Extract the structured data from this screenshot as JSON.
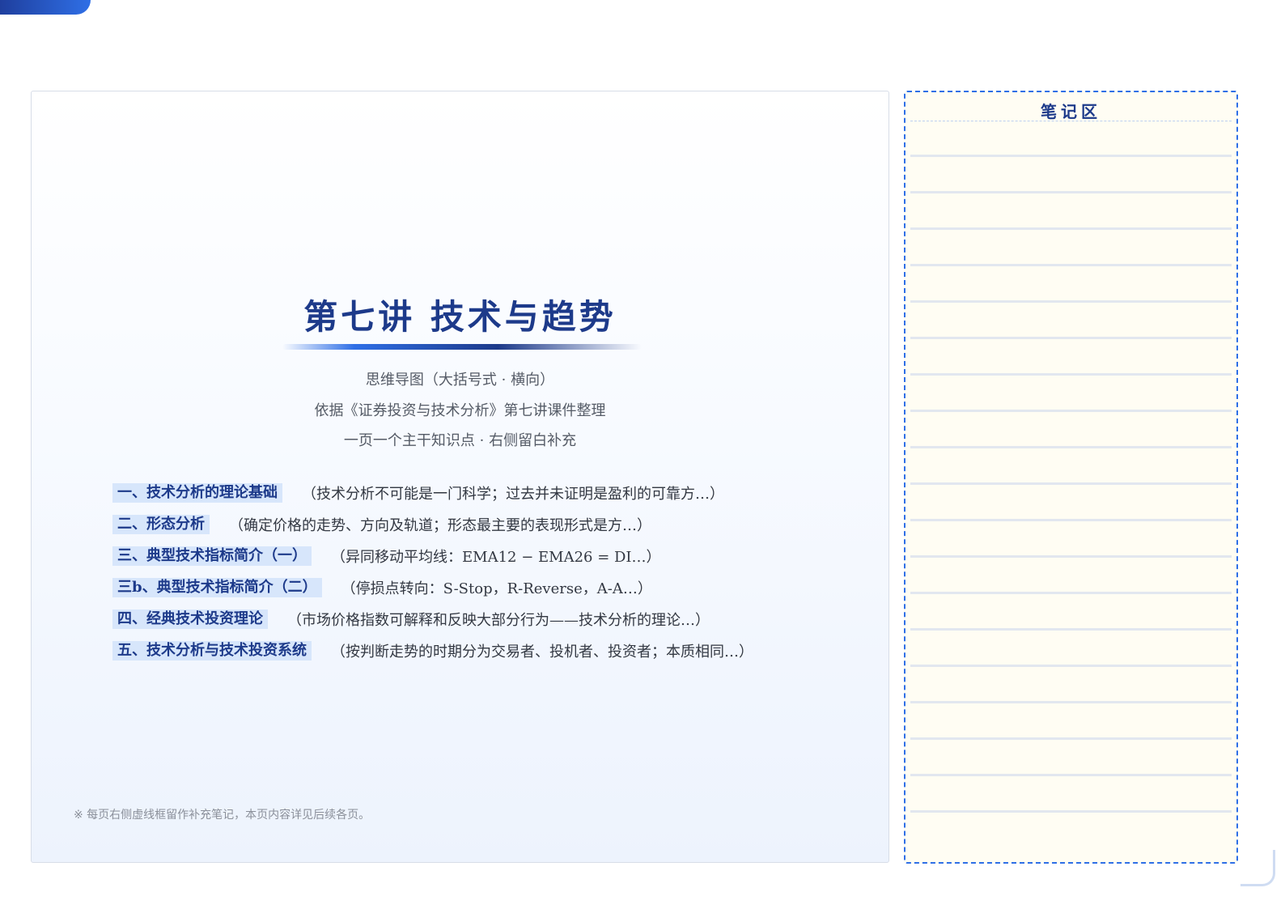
{
  "main": {
    "title": "第七讲  技术与趋势",
    "subtitles": [
      "思维导图（大括号式 · 横向）",
      "依据《证券投资与技术分析》第七讲课件整理",
      "一页一个主干知识点 · 右侧留白补充"
    ],
    "topics": [
      {
        "label": "一、技术分析的理论基础",
        "desc": "（技术分析不可能是一门科学；过去并未证明是盈利的可靠方…）"
      },
      {
        "label": "二、形态分析",
        "desc": "（确定价格的走势、方向及轨道；形态最主要的表现形式是方…）"
      },
      {
        "label": "三、典型技术指标简介（一）",
        "desc": "（异同移动平均线：EMA12 − EMA26 = DI…）"
      },
      {
        "label": "三b、典型技术指标简介（二）",
        "desc": "（停损点转向：S-Stop，R-Reverse，A-A…）"
      },
      {
        "label": "四、经典技术投资理论",
        "desc": "（市场价格指数可解释和反映大部分行为——技术分析的理论…）"
      },
      {
        "label": "五、技术分析与技术投资系统",
        "desc": "（按判断走势的时期分为交易者、投机者、投资者；本质相同…）"
      }
    ],
    "footnote": "※ 每页右侧虚线框留作补充笔记，本页内容详见后续各页。"
  },
  "notes": {
    "title": "笔记区"
  },
  "colors": {
    "accent": "#1d3a8a",
    "accent_light": "#2f6fe6",
    "label_highlight": "#d7e6fb",
    "notes_bg": "#fffdf3"
  }
}
